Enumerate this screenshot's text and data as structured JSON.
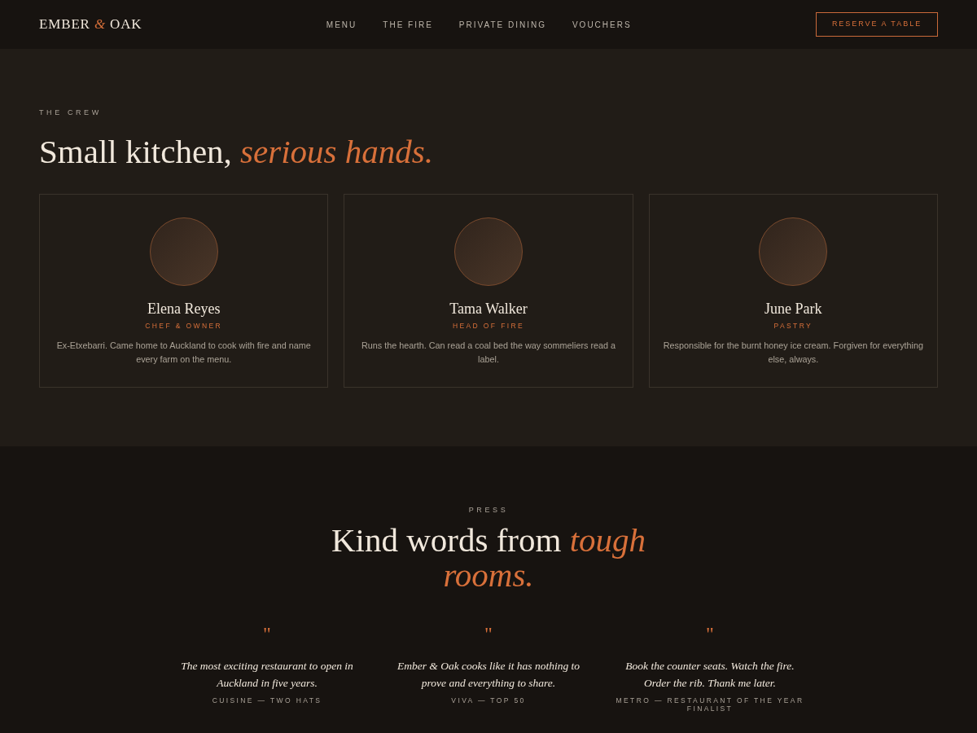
{
  "header": {
    "logo": "EMBER *&* OAK",
    "nav": [
      {
        "label": "MENU"
      },
      {
        "label": "THE FIRE"
      },
      {
        "label": "PRIVATE DINING"
      },
      {
        "label": "VOUCHERS"
      }
    ],
    "cta": "RESERVE A TABLE"
  },
  "crew": {
    "eyebrow": "THE CREW",
    "heading": "Small kitchen, *serious hands.*",
    "members": [
      {
        "name": "Elena Reyes",
        "role": "CHEF & OWNER",
        "bio": "Ex-Etxebarri. Came home to Auckland to cook with fire and name every farm on the menu."
      },
      {
        "name": "Tama Walker",
        "role": "HEAD OF FIRE",
        "bio": "Runs the hearth. Can read a coal bed the way sommeliers read a label."
      },
      {
        "name": "June Park",
        "role": "PASTRY",
        "bio": "Responsible for the burnt honey ice cream. Forgiven for everything else, always."
      }
    ]
  },
  "press": {
    "eyebrow": "PRESS",
    "heading": "Kind words from *tough rooms.*",
    "quotes": [
      {
        "mark": "\"",
        "text": "The most exciting restaurant to open in Auckland in five years.",
        "source": "CUISINE — TWO HATS"
      },
      {
        "mark": "\"",
        "text": "Ember & Oak cooks like it has nothing to prove and everything to share.",
        "source": "VIVA — TOP 50"
      },
      {
        "mark": "\"",
        "text": "Book the counter seats. Watch the fire. Order the rib. Thank me later.",
        "source": "METRO — RESTAURANT OF THE YEAR FINALIST"
      }
    ]
  }
}
